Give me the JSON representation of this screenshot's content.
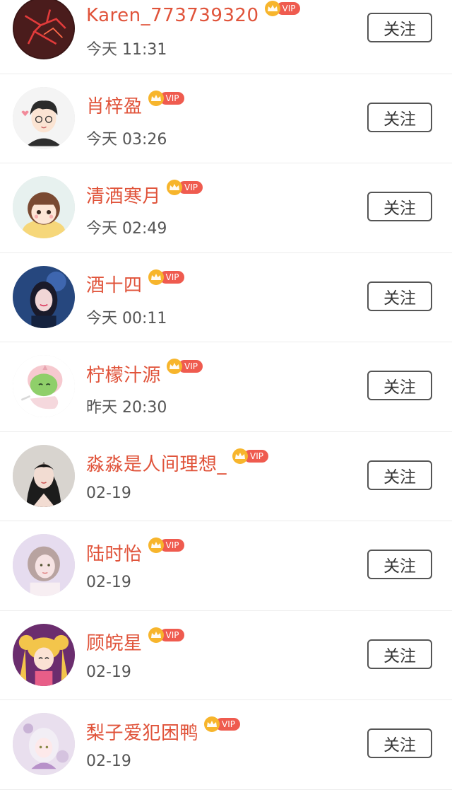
{
  "vip_badge_text": "VIP",
  "follow_label": "关注",
  "colors": {
    "name": "#e0533a",
    "vip_crown": "#f7b52c",
    "vip_pill": "#ef5b4f",
    "time": "#555555",
    "button_border": "#555555"
  },
  "users": [
    {
      "name": "Karen_773739320",
      "time": "今天 11:31",
      "vip": true,
      "avatar_icon": "red-lightning-avatar"
    },
    {
      "name": "肖梓盈",
      "time": "今天 03:26",
      "vip": true,
      "avatar_icon": "cartoon-boy-avatar"
    },
    {
      "name": "清酒寒月",
      "time": "今天 02:49",
      "vip": true,
      "avatar_icon": "cartoon-girl-avatar"
    },
    {
      "name": "酒十四",
      "time": "今天 00:11",
      "vip": true,
      "avatar_icon": "photo-girl-blue-avatar"
    },
    {
      "name": "柠檬汁源",
      "time": "昨天 20:30",
      "vip": true,
      "avatar_icon": "green-dino-avatar"
    },
    {
      "name": "淼淼是人间理想_",
      "time": "02-19",
      "vip": true,
      "avatar_icon": "photo-woman-avatar"
    },
    {
      "name": "陆时怡",
      "time": "02-19",
      "vip": true,
      "avatar_icon": "photo-girl-purple-avatar"
    },
    {
      "name": "顾皖星",
      "time": "02-19",
      "vip": true,
      "avatar_icon": "anime-sailor-avatar"
    },
    {
      "name": "梨子爱犯困鸭",
      "time": "02-19",
      "vip": true,
      "avatar_icon": "pink-anime-avatar"
    }
  ]
}
